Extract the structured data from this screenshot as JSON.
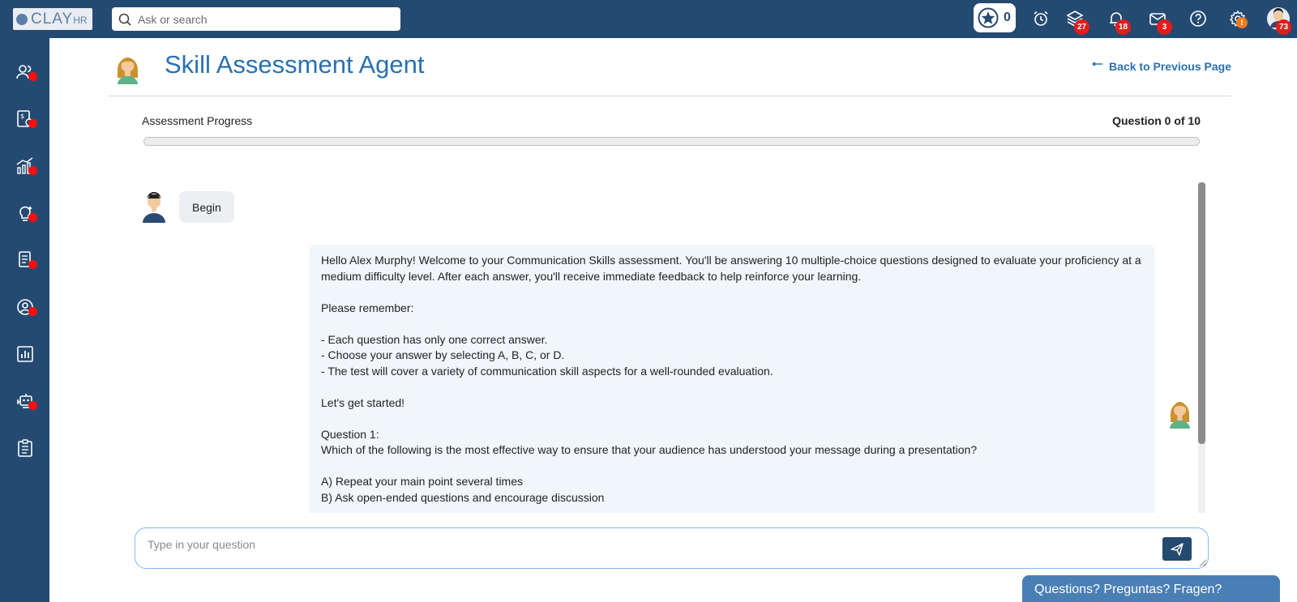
{
  "app": {
    "logo_text": "CLAY",
    "logo_suffix": "HR"
  },
  "search": {
    "placeholder": "Ask or search"
  },
  "topbar": {
    "star_count": "0",
    "badges": {
      "layers": "27",
      "notifications": "18",
      "messages": "3",
      "settings": "!",
      "profile": "73"
    }
  },
  "header": {
    "title": "Skill Assessment Agent",
    "back_label": "Back to Previous Page"
  },
  "progress": {
    "label": "Assessment Progress",
    "count_text": "Question 0 of 10",
    "fraction": 0
  },
  "chat": {
    "user_message": "Begin",
    "bot_message_lines": [
      "Hello Alex Murphy! Welcome to your Communication Skills assessment. You'll be answering 10 multiple-choice questions designed to evaluate your proficiency at a",
      "medium difficulty level. After each answer, you'll receive immediate feedback to help reinforce your learning.",
      "",
      "Please remember:",
      "",
      "- Each question has only one correct answer.",
      "- Choose your answer by selecting A, B, C, or D.",
      "- The test will cover a variety of communication skill aspects for a well-rounded evaluation.",
      "",
      "Let's get started!",
      "",
      "Question 1:",
      "Which of the following is the most effective way to ensure that your audience has understood your message during a presentation?",
      "",
      "A) Repeat your main point several times",
      "B) Ask open-ended questions and encourage discussion"
    ]
  },
  "composer": {
    "placeholder": "Type in your question"
  },
  "help_tab": {
    "label": "Questions? Preguntas? Fragen?"
  },
  "colors": {
    "navy": "#254a72",
    "accent_blue": "#2a70b2",
    "badge_red": "#e51b1b",
    "badge_orange": "#f07c1b",
    "bot_bubble": "#f1f6fc"
  }
}
